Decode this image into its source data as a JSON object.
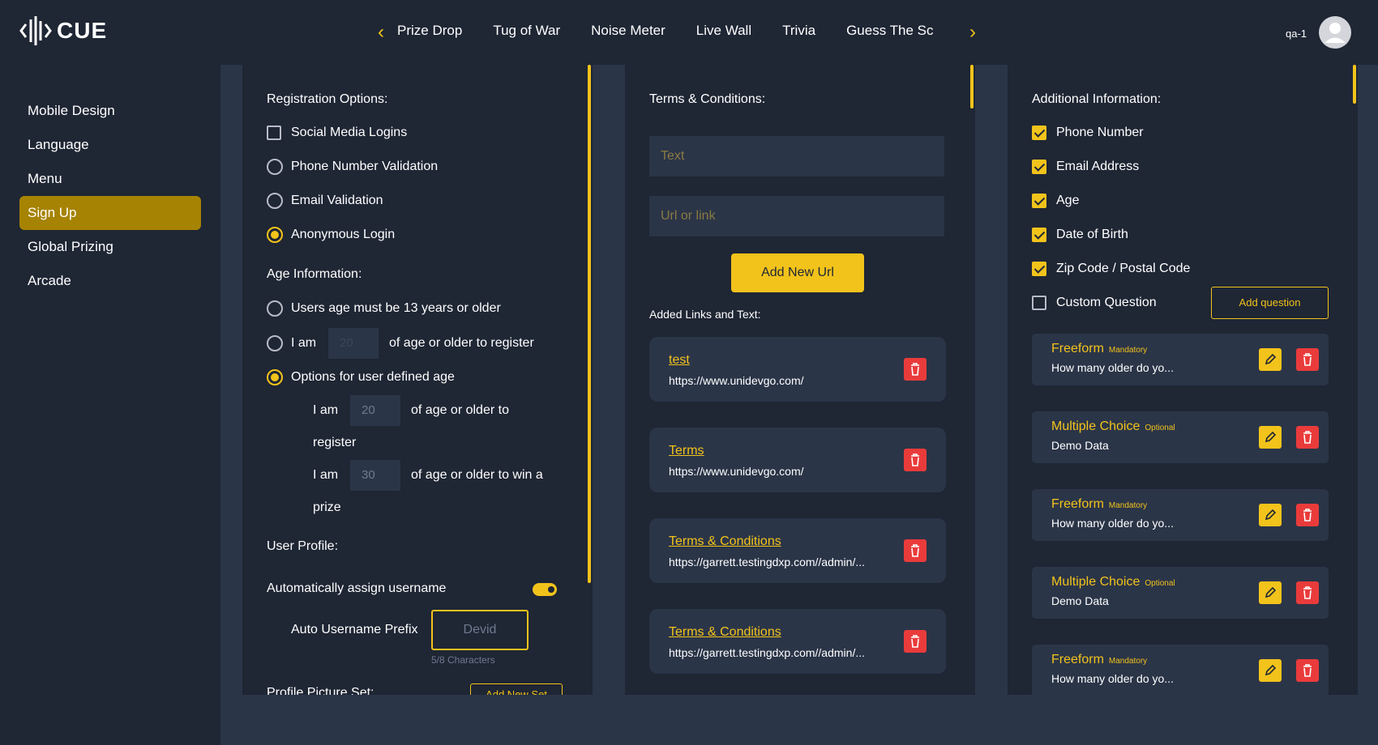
{
  "app": {
    "logo_text": "CUE"
  },
  "nav": {
    "tabs": [
      "Prize Drop",
      "Tug of War",
      "Noise Meter",
      "Live Wall",
      "Trivia",
      "Guess The Sc"
    ]
  },
  "user": {
    "name": "qa-1"
  },
  "sidebar": {
    "items": [
      "Mobile Design",
      "Language",
      "Menu",
      "Sign Up",
      "Global Prizing",
      "Arcade"
    ],
    "active": "Sign Up"
  },
  "registration": {
    "title": "Registration Options:",
    "social": "Social Media Logins",
    "phone": "Phone Number Validation",
    "email": "Email Validation",
    "anonymous": "Anonymous Login"
  },
  "age": {
    "title": "Age Information:",
    "opt1": "Users age must be 13 years or older",
    "opt2_prefix": "I am",
    "opt2_value": "20",
    "opt2_suffix": "of age or older to register",
    "opt3": "Options for user defined age",
    "row1_prefix": "I am",
    "row1_value": "20",
    "row1_suffix": "of age or older to",
    "row1_cont": "register",
    "row2_prefix": "I am",
    "row2_value": "30",
    "row2_suffix": "of age or older to win a",
    "row2_cont": "prize"
  },
  "profile": {
    "title": "User Profile:",
    "auto_assign": "Automatically assign username",
    "prefix_label": "Auto Username Prefix",
    "prefix_value": "Devid",
    "char_count": "5/8 Characters",
    "picture_set": "Profile Picture Set:",
    "add_set": "Add New Set"
  },
  "terms": {
    "title": "Terms & Conditions:",
    "text_placeholder": "Text",
    "url_placeholder": "Url or link",
    "add_button": "Add New Url",
    "added_title": "Added Links and Text:",
    "links": [
      {
        "title": "test",
        "url": "https://www.unidevgo.com/"
      },
      {
        "title": "Terms",
        "url": "https://www.unidevgo.com/"
      },
      {
        "title": "Terms & Conditions",
        "url": "https://garrett.testingdxp.com//admin/..."
      },
      {
        "title": "Terms & Conditions",
        "url": "https://garrett.testingdxp.com//admin/..."
      }
    ]
  },
  "additional": {
    "title": "Additional Information:",
    "phone": "Phone Number",
    "email": "Email Address",
    "age": "Age",
    "dob": "Date of Birth",
    "zip": "Zip Code / Postal Code",
    "custom": "Custom Question",
    "add_question": "Add question",
    "questions": [
      {
        "type": "Freeform",
        "badge": "Mandatory",
        "text": "How many older do yo..."
      },
      {
        "type": "Multiple Choice",
        "badge": "Optional",
        "text": "Demo Data"
      },
      {
        "type": "Freeform",
        "badge": "Mandatory",
        "text": "How many older do yo..."
      },
      {
        "type": "Multiple Choice",
        "badge": "Optional",
        "text": "Demo Data"
      },
      {
        "type": "Freeform",
        "badge": "Mandatory",
        "text": "How many older do yo..."
      }
    ]
  },
  "colors": {
    "accent": "#f2c31b",
    "background": "#1f2634",
    "panel": "#2b3548",
    "active_nav": "#a68302",
    "danger": "#ea3b3b"
  }
}
